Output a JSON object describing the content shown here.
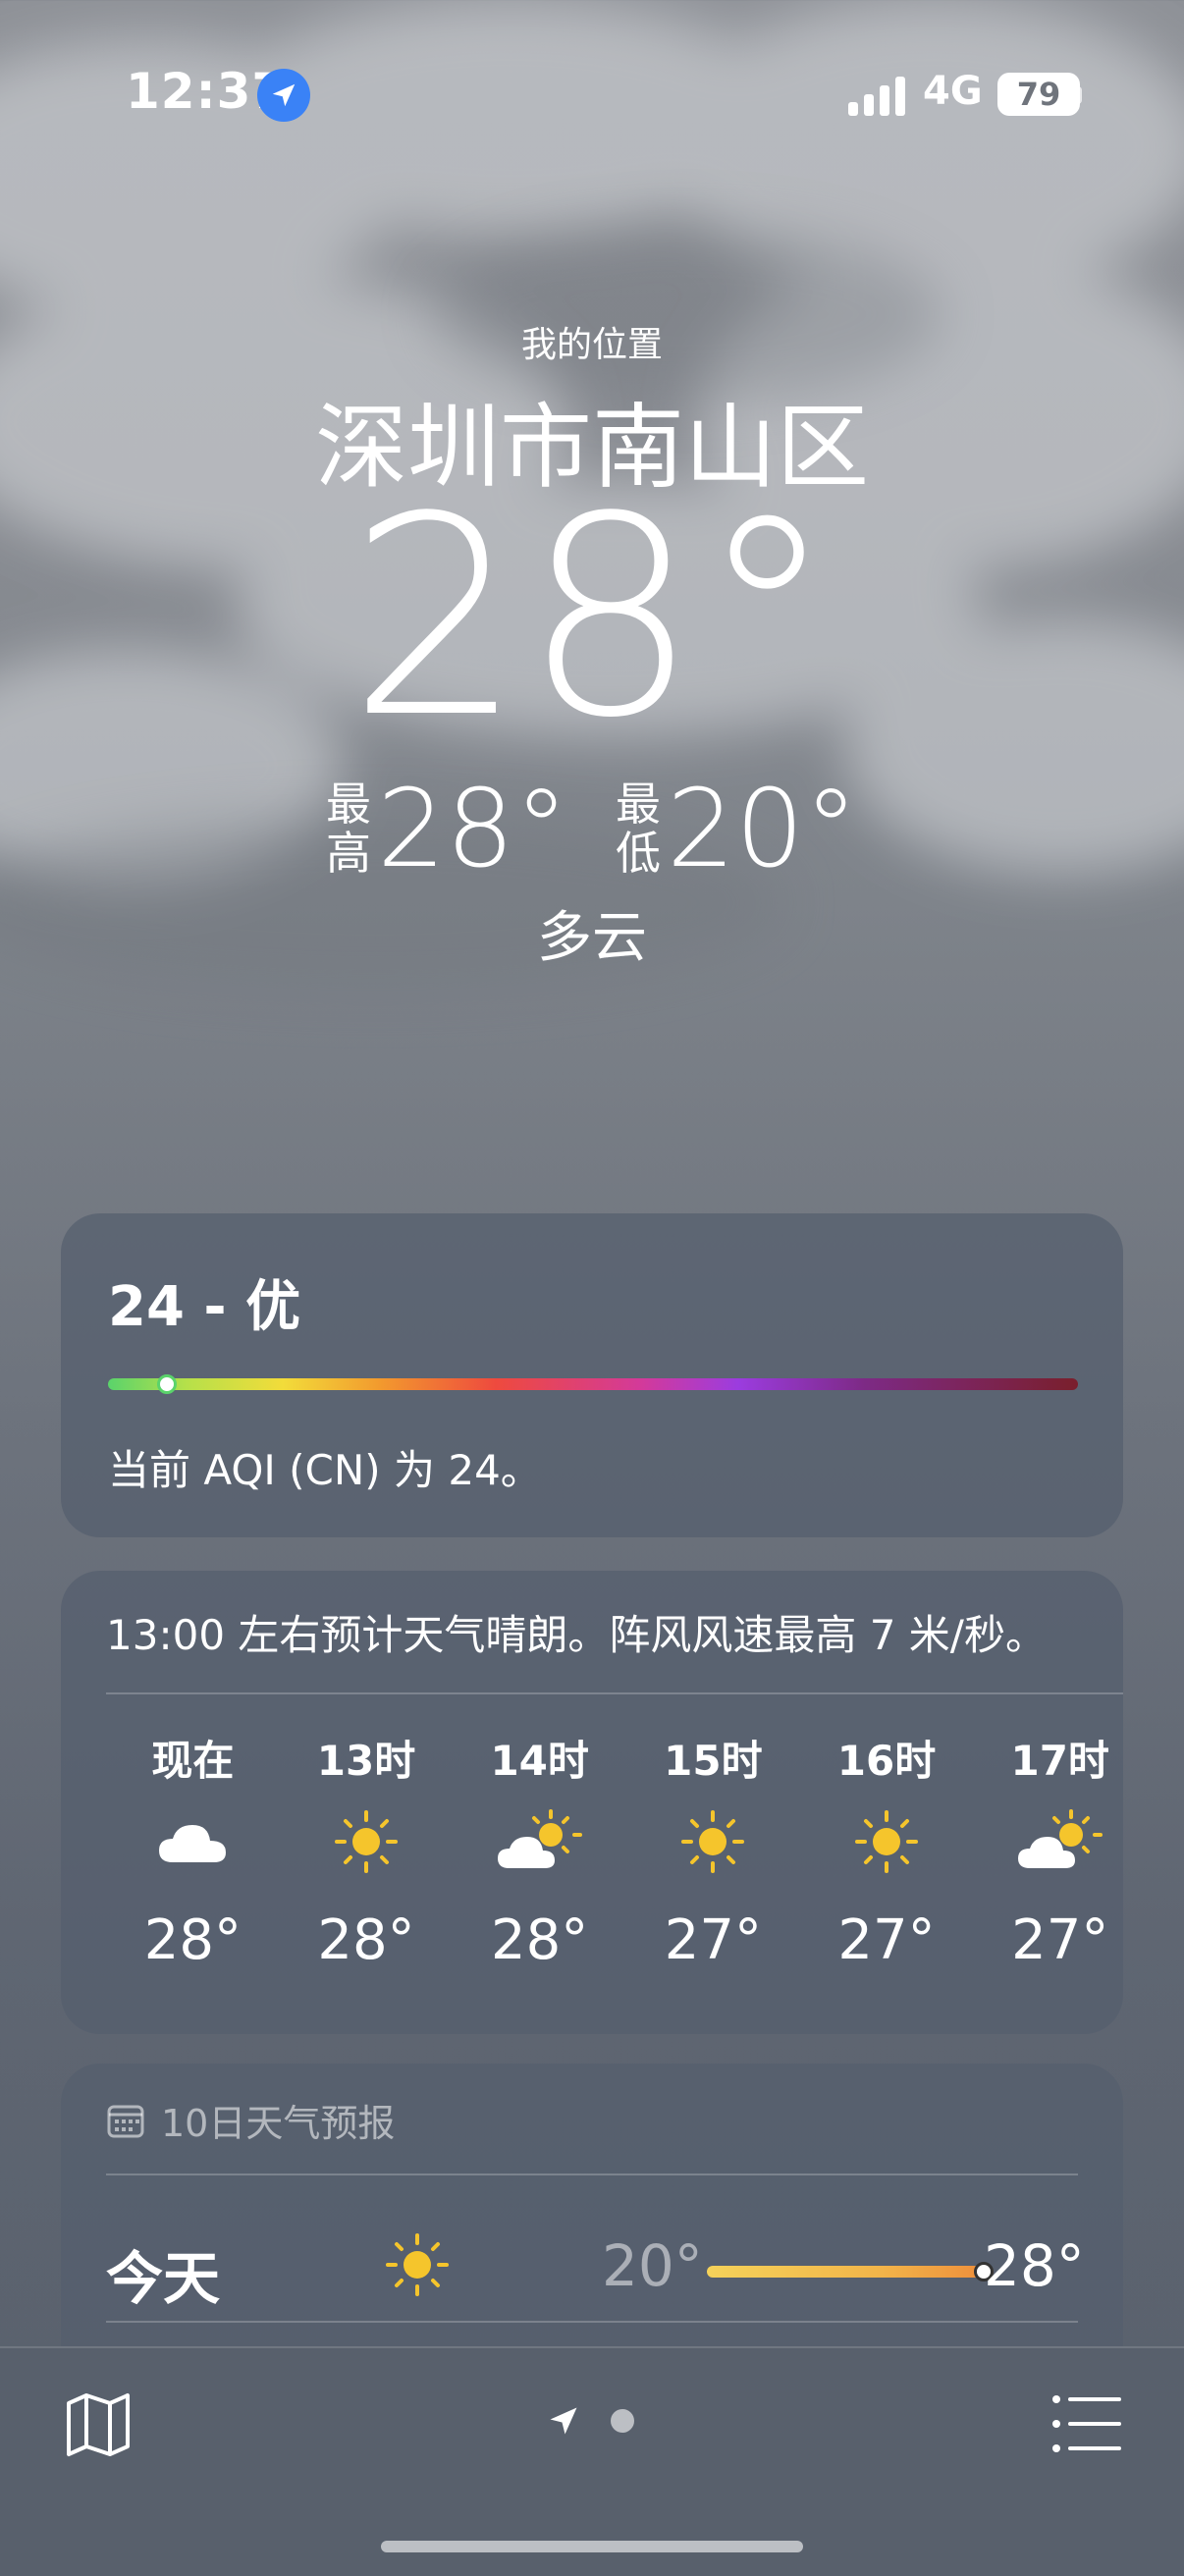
{
  "status_bar": {
    "time": "12:37",
    "network": "4G",
    "battery": "79"
  },
  "header": {
    "my_location": "我的位置",
    "city": "深圳市南山区",
    "current_temp": "28°",
    "high_label": "最\n高",
    "high_label_1": "最",
    "high_label_2": "高",
    "high_temp": "28°",
    "low_label_1": "最",
    "low_label_2": "低",
    "low_temp": "20°",
    "condition": "多云"
  },
  "aqi": {
    "title": "24 - 优",
    "value": 24,
    "description": "当前 AQI (CN) 为 24。"
  },
  "hourly": {
    "summary": "13:00 左右预计天气晴朗。阵风风速最高 7 米/秒。",
    "items": [
      {
        "label": "现在",
        "icon": "cloud-icon",
        "temp": "28°"
      },
      {
        "label": "13时",
        "icon": "sun-icon",
        "temp": "28°"
      },
      {
        "label": "14时",
        "icon": "partly-sunny-icon",
        "temp": "28°"
      },
      {
        "label": "15时",
        "icon": "sun-icon",
        "temp": "27°"
      },
      {
        "label": "16时",
        "icon": "sun-icon",
        "temp": "27°"
      },
      {
        "label": "17时",
        "icon": "partly-sunny-icon",
        "temp": "27°"
      }
    ]
  },
  "forecast": {
    "header": "10日天气预报",
    "rows": [
      {
        "day": "今天",
        "icon": "sun-icon",
        "low": "20°",
        "high": "28°"
      }
    ]
  },
  "colors": {
    "accent_blue": "#3a82f6",
    "sun_yellow": "#f5c52c",
    "aqi_good_green": "#5ad36b"
  }
}
